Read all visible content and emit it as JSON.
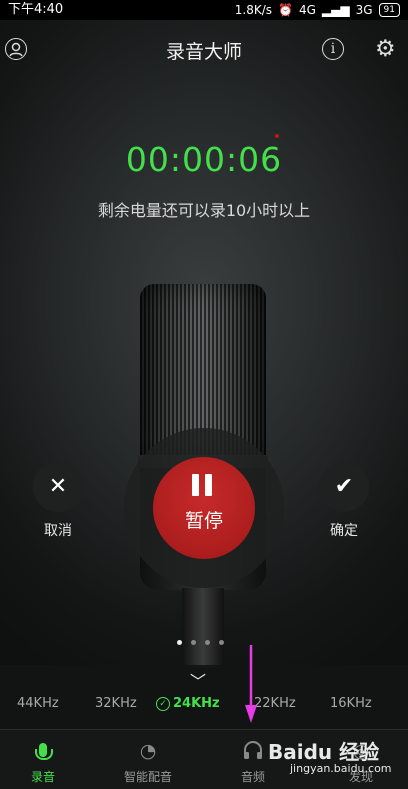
{
  "status_bar": {
    "time": "下午4:40",
    "speed": "1.8K/s",
    "network_4g": "4G",
    "network_3g": "3G",
    "battery": "91"
  },
  "header": {
    "title": "录音大师"
  },
  "recorder": {
    "timer": "00:00:06",
    "hint": "剩余电量还可以录10小时以上",
    "pause_label": "暂停",
    "cancel_label": "取消",
    "confirm_label": "确定",
    "page_dots": 4,
    "active_page": 1
  },
  "frequencies": {
    "items": [
      "44KHz",
      "32KHz",
      "24KHz",
      "22KHz",
      "16KHz"
    ],
    "selected": "24KHz"
  },
  "bottom_nav": {
    "items": [
      {
        "label": "录音",
        "icon": "microphone-icon",
        "active": true
      },
      {
        "label": "智能配音",
        "icon": "dubbing-icon",
        "active": false
      },
      {
        "label": "音频",
        "icon": "headphones-icon",
        "active": false
      },
      {
        "label": "发现",
        "icon": "discover-icon",
        "active": false
      }
    ]
  },
  "watermark": {
    "brand": "Baidu 经验",
    "url": "jingyan.baidu.com"
  },
  "colors": {
    "accent_green": "#44e04c",
    "record_red": "#b01e1e",
    "annotation_arrow": "#e63be6"
  }
}
